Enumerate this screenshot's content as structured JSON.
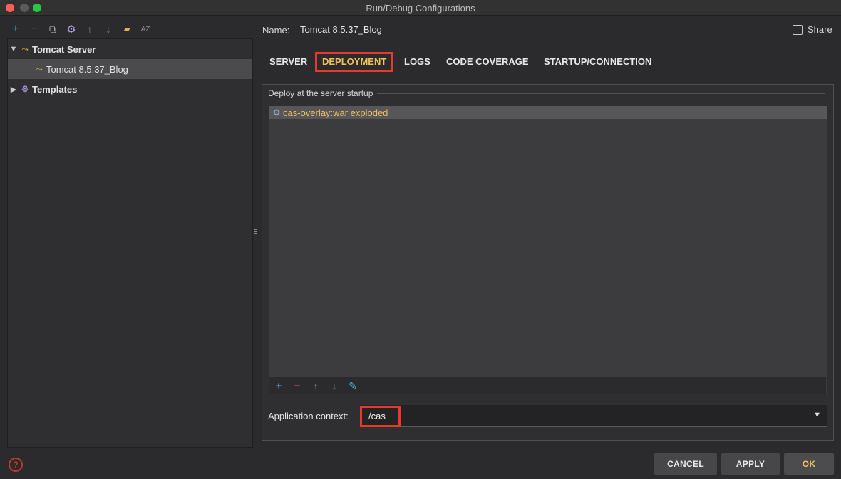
{
  "window": {
    "title": "Run/Debug Configurations"
  },
  "left_toolbar": {
    "icons": [
      {
        "name": "add-icon",
        "glyph": "+",
        "color": "#4fb3d9"
      },
      {
        "name": "remove-icon",
        "glyph": "−",
        "color": "#e05555"
      },
      {
        "name": "copy-icon",
        "glyph": "⧉",
        "color": "#c8c8c8"
      },
      {
        "name": "settings-icon",
        "glyph": "⚙",
        "color": "#b9a0e8"
      },
      {
        "name": "move-up-icon",
        "glyph": "↑",
        "color": "#8a8a8a"
      },
      {
        "name": "move-down-icon",
        "glyph": "↓",
        "color": "#8a8a8a"
      },
      {
        "name": "folder-icon",
        "glyph": "▰",
        "color": "#e0b04a"
      },
      {
        "name": "sort-icon",
        "glyph": "AZ",
        "color": "#8a8a8a"
      }
    ]
  },
  "tree": {
    "tomcat_server": "Tomcat Server",
    "tomcat_config": "Tomcat 8.5.37_Blog",
    "templates": "Templates"
  },
  "form": {
    "name_label": "Name:",
    "name_value": "Tomcat 8.5.37_Blog",
    "share_label": "Share"
  },
  "tabs": [
    "SERVER",
    "DEPLOYMENT",
    "LOGS",
    "CODE COVERAGE",
    "STARTUP/CONNECTION"
  ],
  "deployment": {
    "group_title": "Deploy at the server startup",
    "items": [
      "cas-overlay:war exploded"
    ],
    "list_toolbar": [
      {
        "name": "add-icon",
        "glyph": "+",
        "color": "#4fb3d9"
      },
      {
        "name": "remove-icon",
        "glyph": "−",
        "color": "#e05555"
      },
      {
        "name": "move-up-icon",
        "glyph": "↑",
        "color": "#8a8a8a"
      },
      {
        "name": "move-down-icon",
        "glyph": "↓",
        "color": "#8a8a8a"
      },
      {
        "name": "edit-icon",
        "glyph": "✎",
        "color": "#4fb3d9"
      }
    ],
    "context_label": "Application context:",
    "context_value": "/cas"
  },
  "buttons": {
    "cancel": "CANCEL",
    "apply": "APPLY",
    "ok": "OK"
  },
  "help_glyph": "?"
}
